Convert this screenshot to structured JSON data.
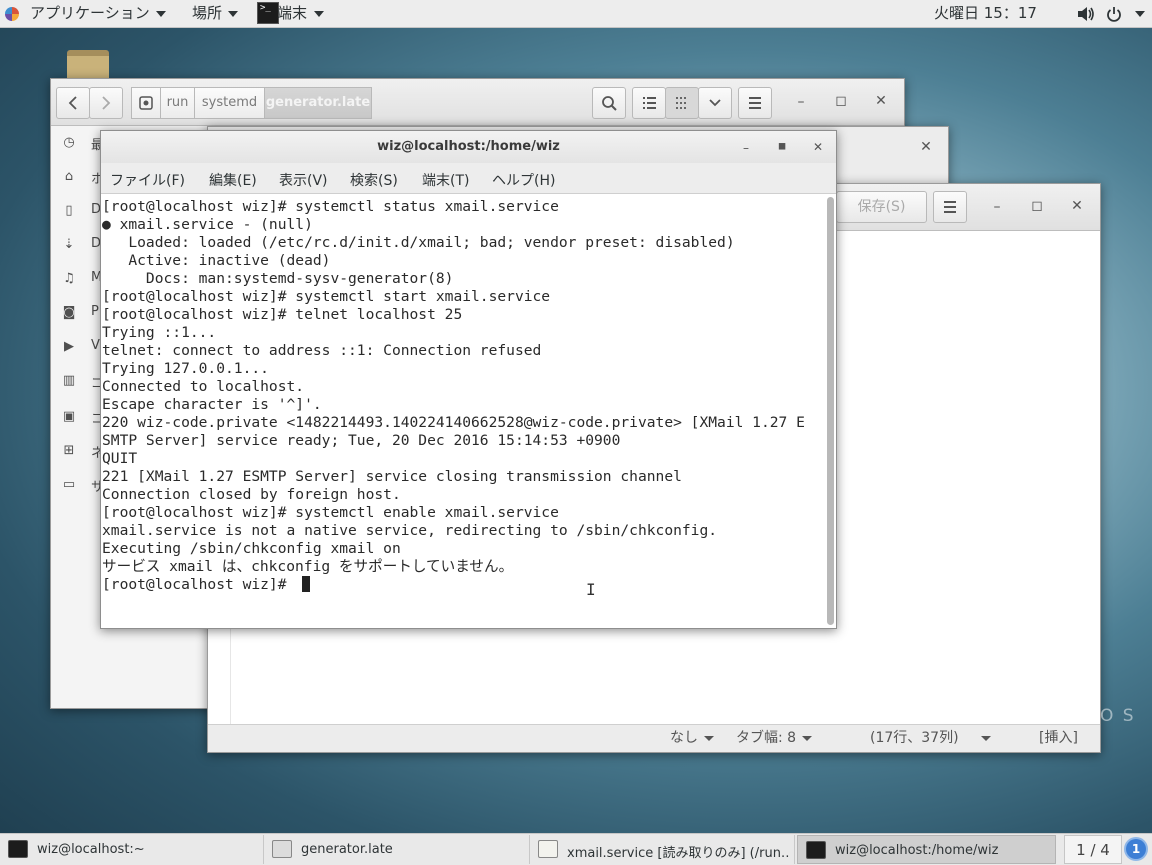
{
  "topbar": {
    "applications": "アプリケーション",
    "places": "場所",
    "terminal": "端末",
    "clock": "火曜日 15：17"
  },
  "file_manager": {
    "breadcrumbs": [
      "run",
      "systemd",
      "generator.late"
    ],
    "sidebar_labels": [
      "最",
      "ホ",
      "D",
      "D",
      "M",
      "P",
      "V",
      "ゴ",
      "コ",
      "ネ",
      "サ"
    ]
  },
  "editor": {
    "save_label": "保存(S)",
    "status": {
      "highlight": "なし",
      "tab_width": "タブ幅: 8",
      "position": "(17行、37列)",
      "mode": "[挿入]"
    }
  },
  "watermark": "O S",
  "terminal": {
    "title": "wiz@localhost:/home/wiz",
    "menu": [
      "ファイル(F)",
      "編集(E)",
      "表示(V)",
      "検索(S)",
      "端末(T)",
      "ヘルプ(H)"
    ],
    "lines": [
      "[root@localhost wiz]# systemctl status xmail.service",
      "● xmail.service - (null)",
      "   Loaded: loaded (/etc/rc.d/init.d/xmail; bad; vendor preset: disabled)",
      "   Active: inactive (dead)",
      "     Docs: man:systemd-sysv-generator(8)",
      "[root@localhost wiz]# systemctl start xmail.service",
      "[root@localhost wiz]# telnet localhost 25",
      "Trying ::1...",
      "telnet: connect to address ::1: Connection refused",
      "Trying 127.0.0.1...",
      "Connected to localhost.",
      "Escape character is '^]'.",
      "220 wiz-code.private <1482214493.140224140662528@wiz-code.private> [XMail 1.27 E",
      "SMTP Server] service ready; Tue, 20 Dec 2016 15:14:53 +0900",
      "QUIT",
      "221 [XMail 1.27 ESMTP Server] service closing transmission channel",
      "Connection closed by foreign host.",
      "[root@localhost wiz]# systemctl enable xmail.service",
      "xmail.service is not a native service, redirecting to /sbin/chkconfig.",
      "Executing /sbin/chkconfig xmail on",
      "サービス xmail は、chkconfig をサポートしていません。",
      "[root@localhost wiz]# "
    ]
  },
  "taskbar": {
    "tasks": [
      "wiz@localhost:~",
      "generator.late",
      "xmail.service [読み取りのみ] (/run…",
      "wiz@localhost:/home/wiz"
    ],
    "workspace": "1 / 4",
    "notifications": "1"
  },
  "colors": {
    "accent": "#3d7fd5",
    "terminal_bg": "#ffffff",
    "panel_bg": "#ededed"
  }
}
